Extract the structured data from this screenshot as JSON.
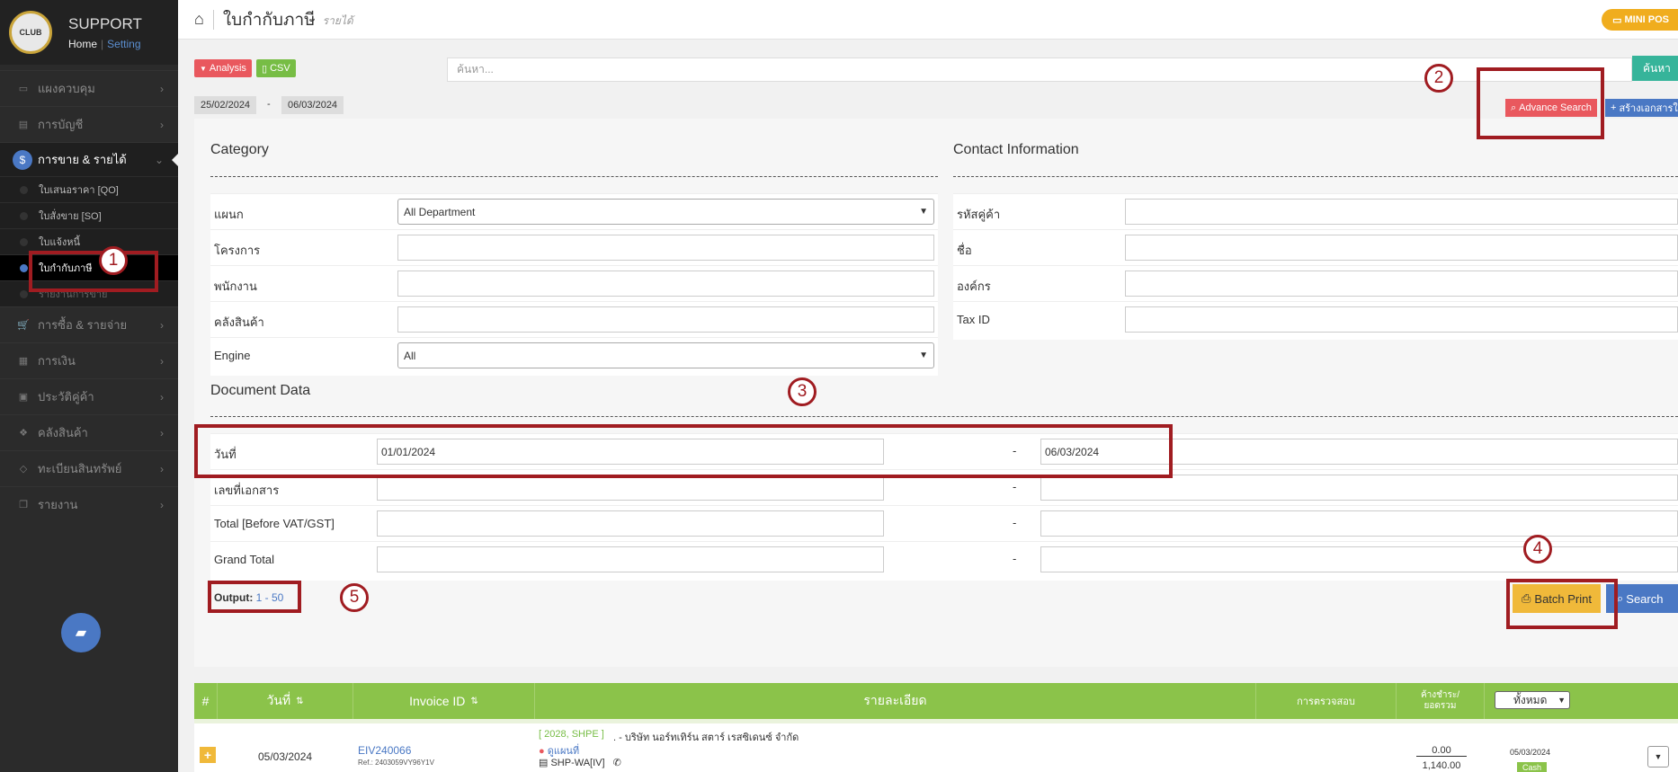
{
  "brand": {
    "logo_text": "CLUB",
    "title": "SUPPORT",
    "home": "Home",
    "sep": "|",
    "setting": "Setting"
  },
  "sidebar": {
    "items": [
      {
        "label": "แผงควบคุม",
        "icon": "monitor-icon"
      },
      {
        "label": "การบัญชี",
        "icon": "book-icon"
      },
      {
        "label": "การขาย & รายได้",
        "icon": "dollar-icon"
      },
      {
        "label": "การซื้อ & รายจ่าย",
        "icon": "cart-icon"
      },
      {
        "label": "การเงิน",
        "icon": "calendar-icon"
      },
      {
        "label": "ประวัติคู่ค้า",
        "icon": "contact-icon"
      },
      {
        "label": "คลังสินค้า",
        "icon": "boxes-icon"
      },
      {
        "label": "ทะเบียนสินทรัพย์",
        "icon": "diamond-icon"
      },
      {
        "label": "รายงาน",
        "icon": "copy-icon"
      }
    ],
    "subitems": [
      "ใบเสนอราคา [QO]",
      "ใบสั่งขาย [SO]",
      "ใบแจ้งหนี้",
      "ใบกำกับภาษี",
      "รายงานการขาย"
    ]
  },
  "header": {
    "title": "ใบกำกับภาษี",
    "subtitle": "รายได้",
    "minipos": "MINI POS"
  },
  "toolbar": {
    "analysis": "Analysis",
    "csv": "CSV",
    "search_placeholder": "ค้นหา...",
    "search_button": "ค้นหา",
    "date_from": "25/02/2024",
    "date_to": "06/03/2024",
    "date_sep": "-",
    "advance_search": "Advance Search",
    "create_doc": "สร้างเอกสารใหม่"
  },
  "form": {
    "category_title": "Category",
    "contact_title": "Contact Information",
    "document_title": "Document Data",
    "department_label": "แผนก",
    "department_value": "All Department",
    "project_label": "โครงการ",
    "employee_label": "พนักงาน",
    "warehouse_label": "คลังสินค้า",
    "engine_label": "Engine",
    "engine_value": "All",
    "customer_code_label": "รหัสคู่ค้า",
    "name_label": "ชื่อ",
    "org_label": "องค์กร",
    "taxid_label": "Tax ID",
    "date_label": "วันที่",
    "date_from": "01/01/2024",
    "date_to": "06/03/2024",
    "docno_label": "เลขที่เอกสาร",
    "total_label": "Total [Before VAT/GST]",
    "grand_label": "Grand Total",
    "range_dash": "-",
    "output_label": "Output:",
    "output_value": "1 - 50",
    "batch_print": "Batch Print",
    "search": "Search"
  },
  "annotations": [
    "1",
    "2",
    "3",
    "4",
    "5"
  ],
  "table": {
    "headers": {
      "num": "#",
      "date": "วันที่",
      "invoice": "Invoice ID",
      "detail": "รายละเอียด",
      "check": "การตรวจสอบ",
      "balance_l1": "ค้างชำระ/",
      "balance_l2": "ยอดรวม",
      "filter": "ทั้งหมด"
    },
    "rows": [
      {
        "date": "05/03/2024",
        "invoice_id": "EIV240066",
        "ref": "Ref.: 2403059VY96Y1V",
        "tag": "[ 2028, SHPE ]",
        "company": ". - บริษัท นอร์ทเทิร์น สตาร์ เรสซิเดนซ์ จำกัด",
        "map": "ดูแผนที่",
        "channel": "SHP-WA[IV]",
        "outstanding": "0.00",
        "total": "1,140.00",
        "pay_date": "05/03/2024",
        "pay_method": "Cash"
      }
    ]
  }
}
